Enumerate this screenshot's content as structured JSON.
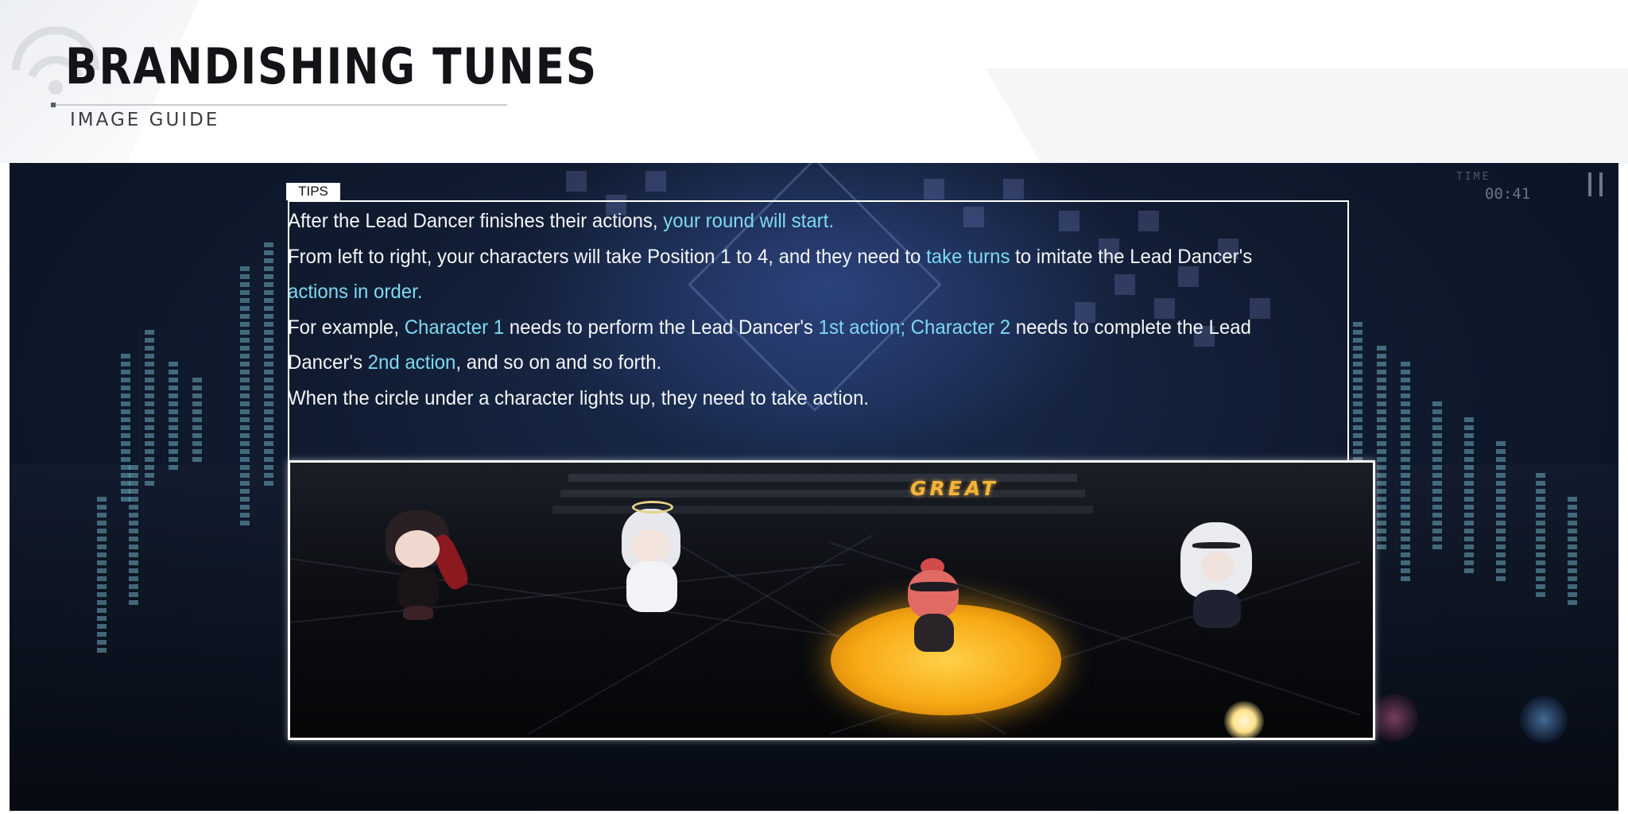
{
  "header": {
    "title": "BRANDISHING TUNES",
    "subtitle": "IMAGE GUIDE"
  },
  "game": {
    "time_label": "TIME",
    "time_value": "00:41",
    "pause_icon": "pause-icon"
  },
  "tips": {
    "badge": "TIPS",
    "lines": [
      [
        {
          "text": "After the Lead Dancer finishes their actions, ",
          "hl": false
        },
        {
          "text": "your round will start.",
          "hl": true
        }
      ],
      [
        {
          "text": "From left to right, your characters will take Position 1 to 4, and they need to ",
          "hl": false
        },
        {
          "text": "take turns",
          "hl": true
        },
        {
          "text": " to imitate the Lead Dancer's ",
          "hl": false
        },
        {
          "text": "actions in order.",
          "hl": true
        }
      ],
      [
        {
          "text": "For example, ",
          "hl": false
        },
        {
          "text": "Character 1",
          "hl": true
        },
        {
          "text": " needs to perform the Lead Dancer's ",
          "hl": false
        },
        {
          "text": "1st action; Character 2",
          "hl": true
        },
        {
          "text": " needs to complete the Lead Dancer's ",
          "hl": false
        },
        {
          "text": "2nd action",
          "hl": true
        },
        {
          "text": ", and so on and so forth.",
          "hl": false
        }
      ],
      [
        {
          "text": "When the circle under a character lights up, they need to take action.",
          "hl": false
        }
      ]
    ]
  },
  "screenshot": {
    "judgement": "GREAT",
    "highlight_color": "#7fd9f2",
    "spotlight_color": "#f7a915"
  }
}
